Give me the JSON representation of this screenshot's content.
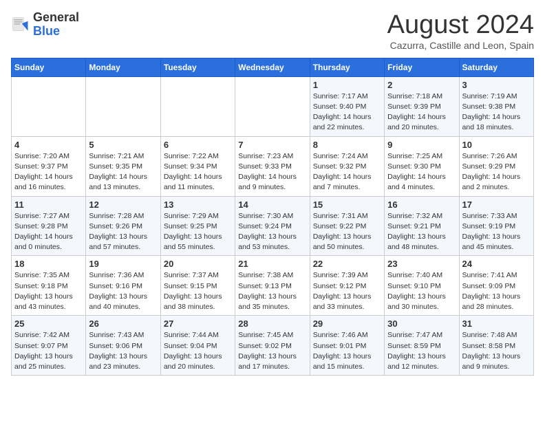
{
  "header": {
    "logo_general": "General",
    "logo_blue": "Blue",
    "title": "August 2024",
    "subtitle": "Cazurra, Castille and Leon, Spain"
  },
  "weekdays": [
    "Sunday",
    "Monday",
    "Tuesday",
    "Wednesday",
    "Thursday",
    "Friday",
    "Saturday"
  ],
  "weeks": [
    [
      {
        "day": "",
        "info": ""
      },
      {
        "day": "",
        "info": ""
      },
      {
        "day": "",
        "info": ""
      },
      {
        "day": "",
        "info": ""
      },
      {
        "day": "1",
        "info": "Sunrise: 7:17 AM\nSunset: 9:40 PM\nDaylight: 14 hours and 22 minutes."
      },
      {
        "day": "2",
        "info": "Sunrise: 7:18 AM\nSunset: 9:39 PM\nDaylight: 14 hours and 20 minutes."
      },
      {
        "day": "3",
        "info": "Sunrise: 7:19 AM\nSunset: 9:38 PM\nDaylight: 14 hours and 18 minutes."
      }
    ],
    [
      {
        "day": "4",
        "info": "Sunrise: 7:20 AM\nSunset: 9:37 PM\nDaylight: 14 hours and 16 minutes."
      },
      {
        "day": "5",
        "info": "Sunrise: 7:21 AM\nSunset: 9:35 PM\nDaylight: 14 hours and 13 minutes."
      },
      {
        "day": "6",
        "info": "Sunrise: 7:22 AM\nSunset: 9:34 PM\nDaylight: 14 hours and 11 minutes."
      },
      {
        "day": "7",
        "info": "Sunrise: 7:23 AM\nSunset: 9:33 PM\nDaylight: 14 hours and 9 minutes."
      },
      {
        "day": "8",
        "info": "Sunrise: 7:24 AM\nSunset: 9:32 PM\nDaylight: 14 hours and 7 minutes."
      },
      {
        "day": "9",
        "info": "Sunrise: 7:25 AM\nSunset: 9:30 PM\nDaylight: 14 hours and 4 minutes."
      },
      {
        "day": "10",
        "info": "Sunrise: 7:26 AM\nSunset: 9:29 PM\nDaylight: 14 hours and 2 minutes."
      }
    ],
    [
      {
        "day": "11",
        "info": "Sunrise: 7:27 AM\nSunset: 9:28 PM\nDaylight: 14 hours and 0 minutes."
      },
      {
        "day": "12",
        "info": "Sunrise: 7:28 AM\nSunset: 9:26 PM\nDaylight: 13 hours and 57 minutes."
      },
      {
        "day": "13",
        "info": "Sunrise: 7:29 AM\nSunset: 9:25 PM\nDaylight: 13 hours and 55 minutes."
      },
      {
        "day": "14",
        "info": "Sunrise: 7:30 AM\nSunset: 9:24 PM\nDaylight: 13 hours and 53 minutes."
      },
      {
        "day": "15",
        "info": "Sunrise: 7:31 AM\nSunset: 9:22 PM\nDaylight: 13 hours and 50 minutes."
      },
      {
        "day": "16",
        "info": "Sunrise: 7:32 AM\nSunset: 9:21 PM\nDaylight: 13 hours and 48 minutes."
      },
      {
        "day": "17",
        "info": "Sunrise: 7:33 AM\nSunset: 9:19 PM\nDaylight: 13 hours and 45 minutes."
      }
    ],
    [
      {
        "day": "18",
        "info": "Sunrise: 7:35 AM\nSunset: 9:18 PM\nDaylight: 13 hours and 43 minutes."
      },
      {
        "day": "19",
        "info": "Sunrise: 7:36 AM\nSunset: 9:16 PM\nDaylight: 13 hours and 40 minutes."
      },
      {
        "day": "20",
        "info": "Sunrise: 7:37 AM\nSunset: 9:15 PM\nDaylight: 13 hours and 38 minutes."
      },
      {
        "day": "21",
        "info": "Sunrise: 7:38 AM\nSunset: 9:13 PM\nDaylight: 13 hours and 35 minutes."
      },
      {
        "day": "22",
        "info": "Sunrise: 7:39 AM\nSunset: 9:12 PM\nDaylight: 13 hours and 33 minutes."
      },
      {
        "day": "23",
        "info": "Sunrise: 7:40 AM\nSunset: 9:10 PM\nDaylight: 13 hours and 30 minutes."
      },
      {
        "day": "24",
        "info": "Sunrise: 7:41 AM\nSunset: 9:09 PM\nDaylight: 13 hours and 28 minutes."
      }
    ],
    [
      {
        "day": "25",
        "info": "Sunrise: 7:42 AM\nSunset: 9:07 PM\nDaylight: 13 hours and 25 minutes."
      },
      {
        "day": "26",
        "info": "Sunrise: 7:43 AM\nSunset: 9:06 PM\nDaylight: 13 hours and 23 minutes."
      },
      {
        "day": "27",
        "info": "Sunrise: 7:44 AM\nSunset: 9:04 PM\nDaylight: 13 hours and 20 minutes."
      },
      {
        "day": "28",
        "info": "Sunrise: 7:45 AM\nSunset: 9:02 PM\nDaylight: 13 hours and 17 minutes."
      },
      {
        "day": "29",
        "info": "Sunrise: 7:46 AM\nSunset: 9:01 PM\nDaylight: 13 hours and 15 minutes."
      },
      {
        "day": "30",
        "info": "Sunrise: 7:47 AM\nSunset: 8:59 PM\nDaylight: 13 hours and 12 minutes."
      },
      {
        "day": "31",
        "info": "Sunrise: 7:48 AM\nSunset: 8:58 PM\nDaylight: 13 hours and 9 minutes."
      }
    ]
  ]
}
